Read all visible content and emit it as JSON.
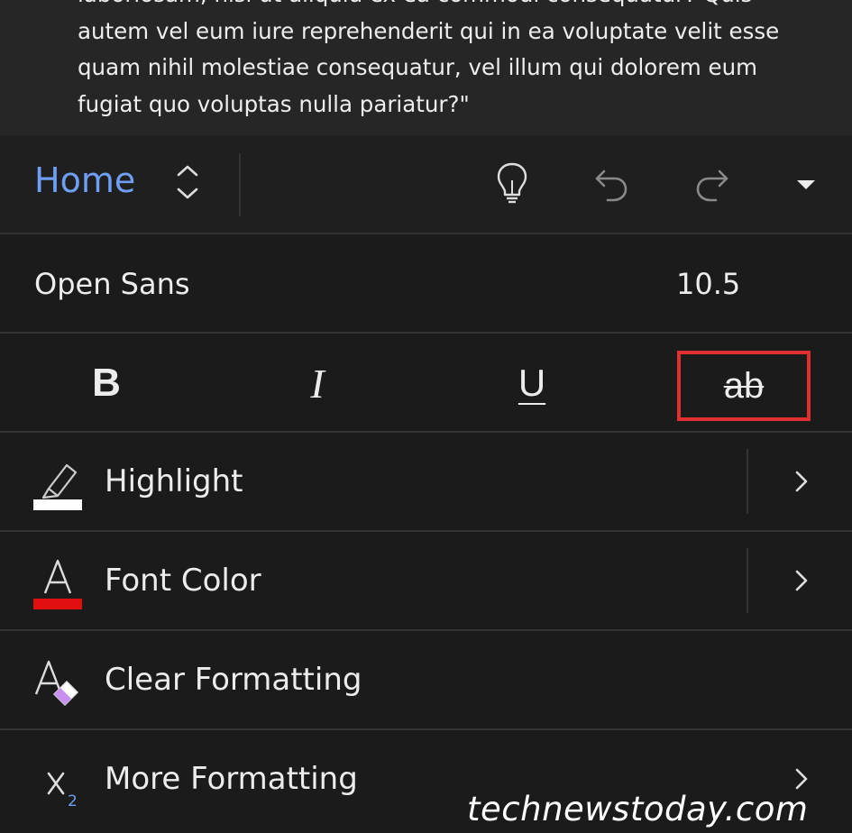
{
  "document": {
    "lines": [
      "laboriosam, nisi ut aliquid ex ea commodi consequatur? Quis",
      "autem vel eum iure reprehenderit qui in ea voluptate velit esse",
      "quam nihil molestiae consequatur, vel illum qui dolorem eum",
      "fugiat quo voluptas nulla pariatur?\""
    ]
  },
  "toolbar": {
    "tab_label": "Home",
    "icons": [
      "chevron-up-down-icon",
      "lightbulb-icon",
      "undo-icon",
      "redo-icon",
      "caret-down-icon"
    ]
  },
  "font": {
    "name": "Open Sans",
    "size": "10.5"
  },
  "style_buttons": {
    "bold": "B",
    "italic": "I",
    "underline": "U",
    "strikethrough": "ab"
  },
  "menu": [
    {
      "label": "Highlight",
      "icon": "highlighter-icon",
      "has_submenu": true
    },
    {
      "label": "Font Color",
      "icon": "font-color-icon",
      "has_submenu": true
    },
    {
      "label": "Clear Formatting",
      "icon": "clear-formatting-icon",
      "has_submenu": false
    },
    {
      "label": "More Formatting",
      "icon": "subscript-icon",
      "has_submenu": true
    }
  ],
  "colors": {
    "accent": "#6f9ef5",
    "highlight_swatch": "#ffffff",
    "font_color_swatch": "#e01010",
    "selection_box": "#e03030",
    "eraser": "#c88ef0"
  },
  "watermark": "technewstoday.com"
}
